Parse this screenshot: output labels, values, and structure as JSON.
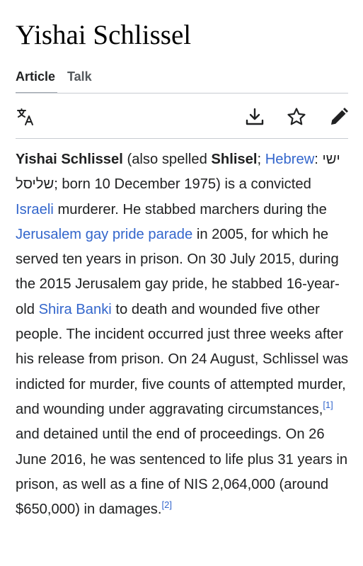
{
  "article": {
    "title": "Yishai Schlissel"
  },
  "tabs": {
    "article_label": "Article",
    "talk_label": "Talk"
  },
  "toolbar": {
    "language_icon": "translate-icon",
    "download_icon": "download-icon",
    "watch_icon": "star-icon",
    "edit_icon": "pencil-icon"
  },
  "body": {
    "name_bold": "Yishai Schlissel",
    "t1": " (also spelled ",
    "alt_bold": "Shlisel",
    "t2": "; ",
    "hebrew_link": "Hebrew",
    "t3": ": ",
    "hebrew_name": "ישי שליסל",
    "t4": "; born 10 December 1975) is a convicted ",
    "israeli_link": "Israeli",
    "t5": " murderer. He stabbed marchers during the ",
    "parade_link": "Jerusalem gay pride parade",
    "t6": " in 2005, for which he served ten years in prison. On 30 July 2015, during the 2015 Jerusalem gay pride, he stabbed 16-year-old ",
    "banki_link": "Shira Banki",
    "t7": " to death and wounded five other people. The incident occurred just three weeks after his release from prison. On 24 August, Schlissel was indicted for murder, five counts of attempted murder, and wounding under aggravating circumstances,",
    "ref1": "[1]",
    "t8": " and detained until the end of proceedings. On 26 June 2016, he was sentenced to life plus 31 years in prison, as well as a fine of NIS 2,064,000 (around $650,000) in damages.",
    "ref2": "[2]"
  },
  "colors": {
    "link": "#3366cc",
    "text": "#202122",
    "divider": "#c8ccd1"
  }
}
